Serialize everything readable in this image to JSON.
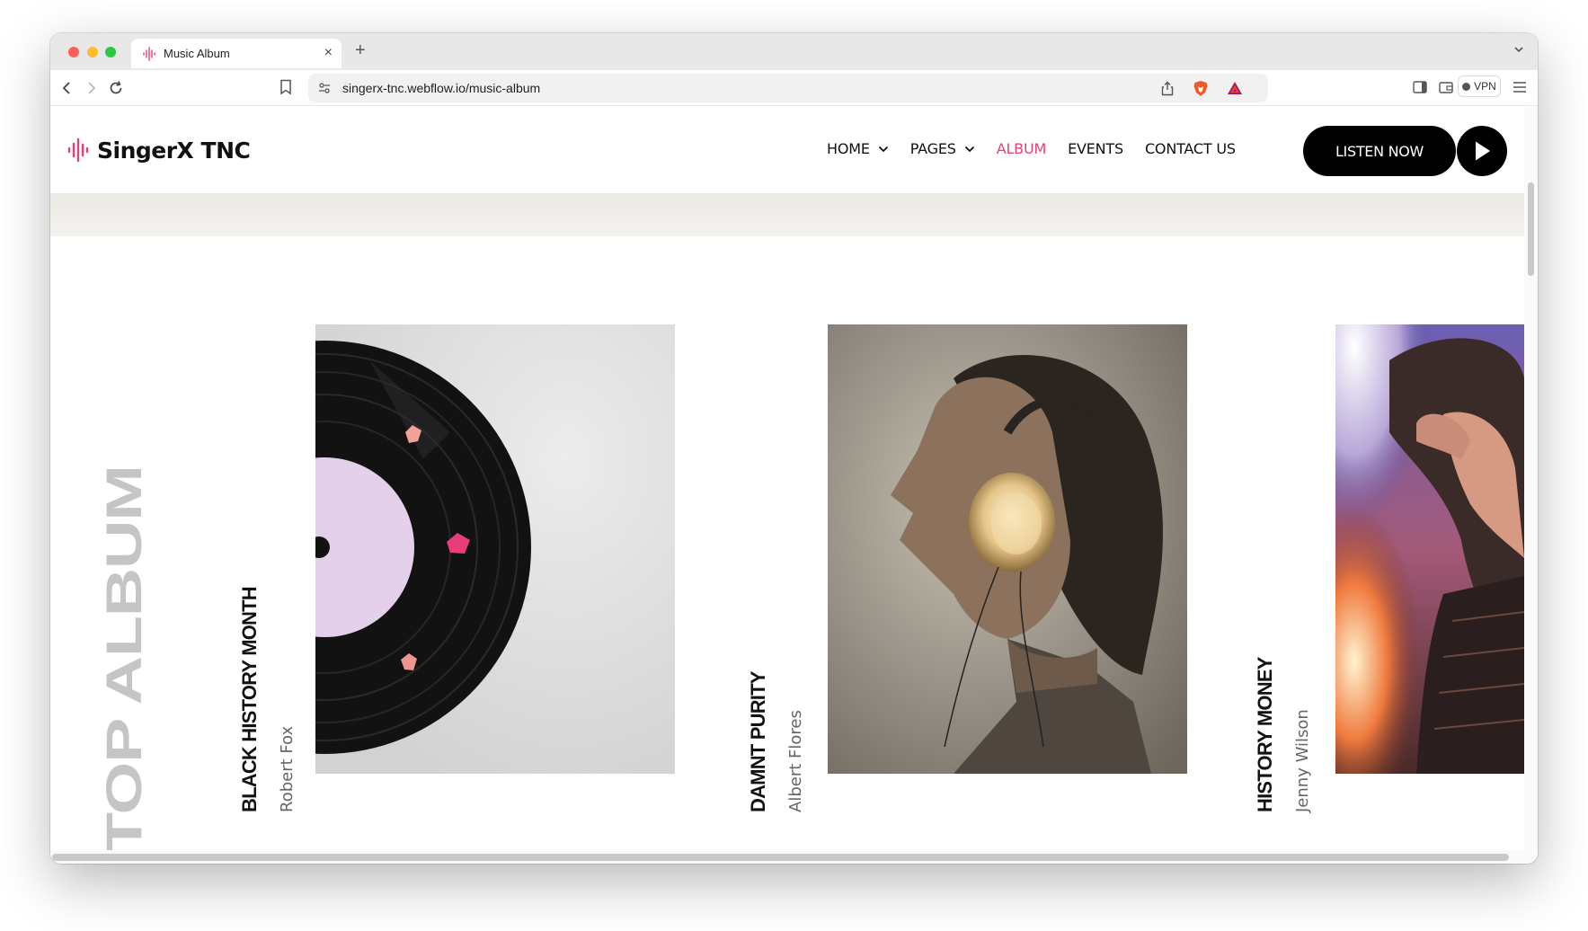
{
  "browser": {
    "tab_title": "Music Album",
    "tab_close": "×",
    "new_tab": "+",
    "url": "singerx-tnc.webflow.io/music-album",
    "vpn_label": "VPN"
  },
  "site": {
    "logo_text": "SingerX TNC",
    "brand_color": "#e0417a",
    "nav": [
      {
        "label": "HOME",
        "has_dropdown": true
      },
      {
        "label": "PAGES",
        "has_dropdown": true
      },
      {
        "label": "ALBUM",
        "active": true
      },
      {
        "label": "EVENTS"
      },
      {
        "label": "CONTACT US"
      }
    ],
    "cta_label": "LISTEN NOW"
  },
  "section": {
    "title": "TOP ALBUM"
  },
  "albums": [
    {
      "name": "BLACK HISTORY MONTH",
      "artist": "Robert Fox",
      "image": "vinyl-record-icon"
    },
    {
      "name": "DAMNT PURITY",
      "artist": "Albert Flores",
      "image": "woman-headphones-photo"
    },
    {
      "name": "HISTORY MONEY",
      "artist": "Jenny Wilson",
      "image": "woman-stage-light-photo"
    }
  ]
}
